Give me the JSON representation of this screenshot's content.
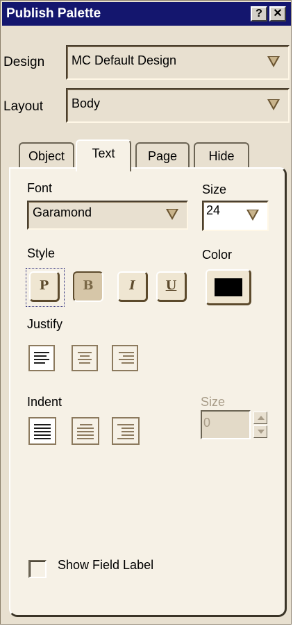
{
  "window": {
    "title": "Publish Palette",
    "help_button": "?",
    "close_button": "✕"
  },
  "design": {
    "label": "Design",
    "value": "MC Default Design"
  },
  "layout": {
    "label": "Layout",
    "value": "Body"
  },
  "tabs": [
    {
      "label": "Object",
      "active": false
    },
    {
      "label": "Text",
      "active": true
    },
    {
      "label": "Page",
      "active": false
    },
    {
      "label": "Hide",
      "active": false
    }
  ],
  "text_panel": {
    "font": {
      "label": "Font",
      "value": "Garamond"
    },
    "size": {
      "label": "Size",
      "value": "24"
    },
    "style": {
      "label": "Style",
      "buttons": [
        {
          "label": "P",
          "icon": "plain-icon",
          "pressed": false
        },
        {
          "label": "B",
          "icon": "bold-icon",
          "pressed": true
        },
        {
          "label": "I",
          "icon": "italic-icon",
          "pressed": false
        },
        {
          "label": "U",
          "icon": "underline-icon",
          "pressed": false
        }
      ]
    },
    "color": {
      "label": "Color",
      "value": "#000000"
    },
    "justify": {
      "label": "Justify",
      "options": [
        "align-left-icon",
        "align-center-icon",
        "align-right-icon"
      ],
      "selected": "align-left-icon"
    },
    "indent": {
      "label": "Indent",
      "options": [
        "indent-none-icon",
        "indent-left-icon",
        "indent-right-icon"
      ],
      "selected": "indent-none-icon"
    },
    "indent_size": {
      "label": "Size",
      "value": "0",
      "disabled": true
    },
    "show_field_label": {
      "label": "Show Field Label",
      "checked": false
    }
  }
}
